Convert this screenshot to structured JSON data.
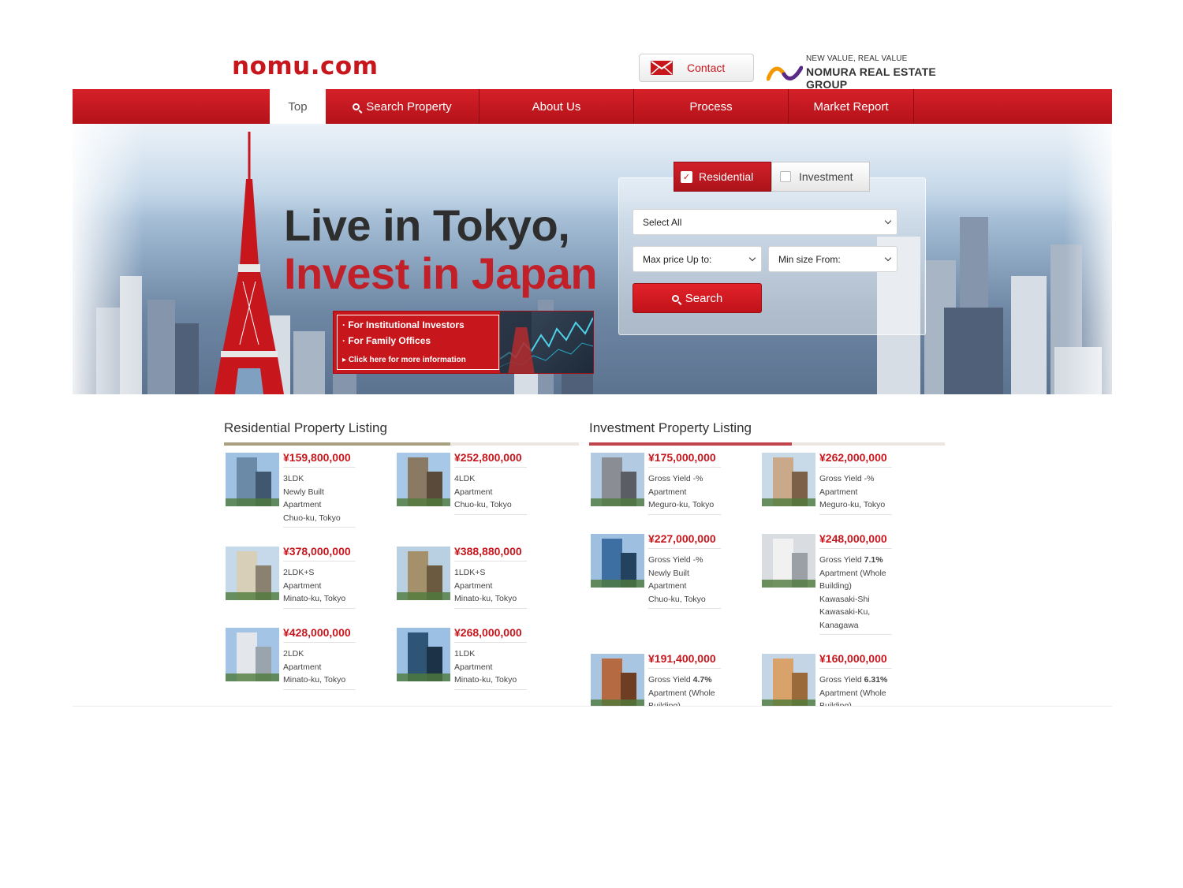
{
  "header": {
    "logo": "nomu.com",
    "contact_label": "Contact",
    "group_tagline": "NEW VALUE, REAL VALUE",
    "group_name": "NOMURA REAL ESTATE GROUP"
  },
  "nav": {
    "items": [
      {
        "label": "Top"
      },
      {
        "label": "Search Property"
      },
      {
        "label": "About Us"
      },
      {
        "label": "Process"
      },
      {
        "label": "Market Report"
      }
    ]
  },
  "hero": {
    "headline_line1": "Live in Tokyo,",
    "headline_line2": "Invest in Japan",
    "banner": {
      "line1": "For Institutional Investors",
      "line2": "For Family Offices",
      "line3": "Click here for more information"
    }
  },
  "search": {
    "tab_residential": "Residential",
    "tab_investment": "Investment",
    "select_all": "Select All",
    "max_price": "Max price Up to:",
    "min_size": "Min size From:",
    "button": "Search"
  },
  "residential": {
    "title": "Residential Property Listing",
    "accent_color": "#a8a07f",
    "items": [
      {
        "price": "¥159,800,000",
        "lines": [
          "3LDK",
          "Newly Built",
          "Apartment",
          "Chuo-ku, Tokyo"
        ]
      },
      {
        "price": "¥252,800,000",
        "lines": [
          "4LDK",
          "Apartment",
          "Chuo-ku, Tokyo"
        ]
      },
      {
        "price": "¥378,000,000",
        "lines": [
          "2LDK+S",
          "Apartment",
          "Minato-ku, Tokyo"
        ]
      },
      {
        "price": "¥388,880,000",
        "lines": [
          "1LDK+S",
          "Apartment",
          "Minato-ku, Tokyo"
        ]
      },
      {
        "price": "¥428,000,000",
        "lines": [
          "2LDK",
          "Apartment",
          "Minato-ku, Tokyo"
        ]
      },
      {
        "price": "¥268,000,000",
        "lines": [
          "1LDK",
          "Apartment",
          "Minato-ku, Tokyo"
        ]
      }
    ]
  },
  "investment": {
    "title": "Investment Property Listing",
    "accent_color": "#c0444a",
    "items": [
      {
        "price": "¥175,000,000",
        "yield_label": "Gross Yield ",
        "yield_value": "-%",
        "lines": [
          "Apartment",
          "Meguro-ku, Tokyo"
        ]
      },
      {
        "price": "¥262,000,000",
        "yield_label": "Gross Yield ",
        "yield_value": "-%",
        "lines": [
          "Apartment",
          "Meguro-ku, Tokyo"
        ]
      },
      {
        "price": "¥227,000,000",
        "yield_label": "Gross Yield ",
        "yield_value": "-%",
        "lines": [
          "Newly Built",
          "Apartment",
          "Chuo-ku, Tokyo"
        ]
      },
      {
        "price": "¥248,000,000",
        "yield_label": "Gross Yield ",
        "yield_value": "7.1%",
        "lines": [
          "Apartment (Whole",
          "Building)",
          "Kawasaki-Shi",
          "Kawasaki-Ku,",
          "Kanagawa"
        ]
      },
      {
        "price": "¥191,400,000",
        "yield_label": "Gross Yield ",
        "yield_value": "4.7%",
        "lines": [
          "Apartment (Whole",
          "Building)"
        ]
      },
      {
        "price": "¥160,000,000",
        "yield_label": "Gross Yield ",
        "yield_value": "6.31%",
        "lines": [
          "Apartment (Whole",
          "Building)"
        ]
      }
    ]
  }
}
